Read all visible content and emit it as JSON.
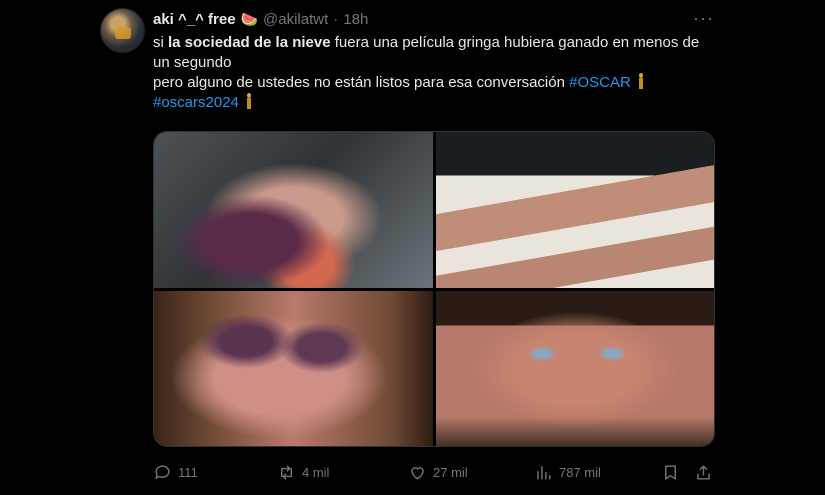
{
  "tweet": {
    "display_name": "aki ^_^ free",
    "name_emoji": "🍉",
    "handle": "@akilatwt",
    "separator": "·",
    "time": "18h",
    "more": "···",
    "text": {
      "line1_pre": "si ",
      "line1_bold": "la sociedad de la nieve",
      "line1_post": " fuera una película gringa hubiera ganado en menos de un segundo",
      "line2": "pero alguno de ustedes no están listos para esa conversación ",
      "hashtag1": "#OSCAR",
      "hashtag2": "#oscars2024"
    },
    "media": [
      {
        "name": "photo-1",
        "desc": "injured foot"
      },
      {
        "name": "photo-2",
        "desc": "thin legs"
      },
      {
        "name": "photo-3",
        "desc": "bruised face"
      },
      {
        "name": "photo-4",
        "desc": "face close-up"
      }
    ],
    "actions": {
      "replies": "111",
      "retweets": "4 mil",
      "likes": "27 mil",
      "views": "787 mil"
    }
  }
}
